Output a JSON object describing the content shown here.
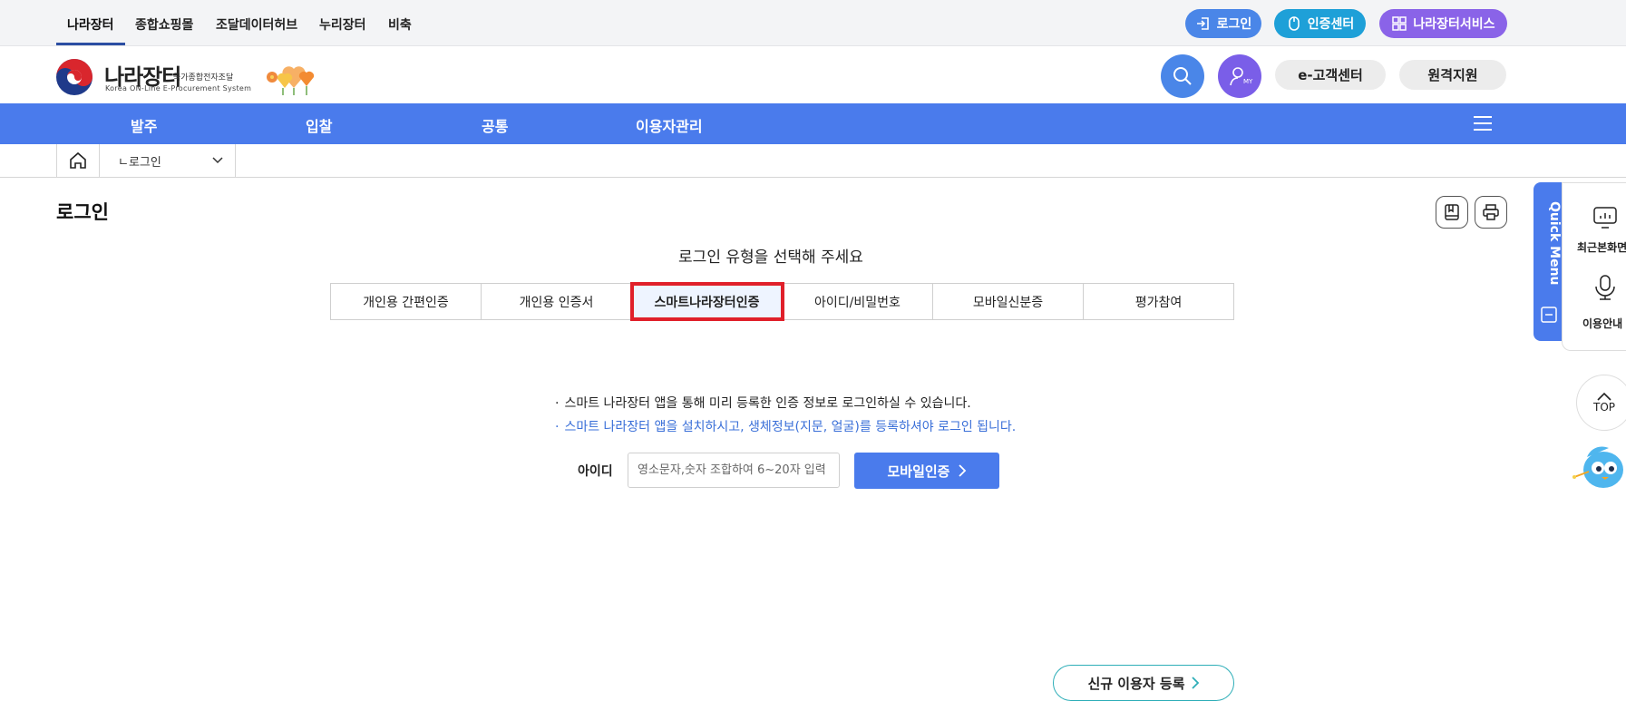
{
  "top_nav": {
    "links": [
      "나라장터",
      "종합쇼핑몰",
      "조달데이터허브",
      "누리장터",
      "비축"
    ],
    "login_label": "로그인",
    "cert_label": "인증센터",
    "services_label": "나라장터서비스"
  },
  "header": {
    "logo_title": "나라장터",
    "logo_sub": "국가종합전자조달",
    "logo_en": "Korea ON-Line E-Procurement System",
    "search_icon": "search-icon",
    "my_label": "MY",
    "customer_center": "e-고객센터",
    "remote_support": "원격지원"
  },
  "main_nav": {
    "items": [
      "발주",
      "입찰",
      "공통",
      "이용자관리"
    ]
  },
  "breadcrumb": {
    "current": "ㄴ로그인"
  },
  "page": {
    "title": "로그인",
    "subtitle": "로그인 유형을 선택해 주세요",
    "tabs": [
      {
        "label": "개인용 간편인증",
        "active": false
      },
      {
        "label": "개인용 인증서",
        "active": false
      },
      {
        "label": "스마트나라장터인증",
        "active": true
      },
      {
        "label": "아이디/비밀번호",
        "active": false
      },
      {
        "label": "모바일신분증",
        "active": false
      },
      {
        "label": "평가참여",
        "active": false
      }
    ],
    "notices": [
      "스마트 나라장터 앱을 통해 미리 등록한 인증 정보로 로그인하실 수 있습니다.",
      "스마트 나라장터 앱을 설치하시고, 생체정보(지문, 얼굴)를 등록하셔야 로그인 됩니다."
    ],
    "id_label": "아이디",
    "id_placeholder": "영소문자,숫자 조합하여 6~20자 입력",
    "mobile_button": "모바일인증",
    "register_button": "신규 이용자 등록"
  },
  "quick_menu": {
    "label": "Quick Menu",
    "items": [
      "최근본화면",
      "이용안내"
    ],
    "top_label": "TOP"
  },
  "colors": {
    "primary": "#4a7bec",
    "cert": "#1ea0d8",
    "services": "#8a63e8",
    "login": "#4a86e8",
    "highlight": "#e0202a",
    "notice_blue": "#3a6fd8"
  }
}
